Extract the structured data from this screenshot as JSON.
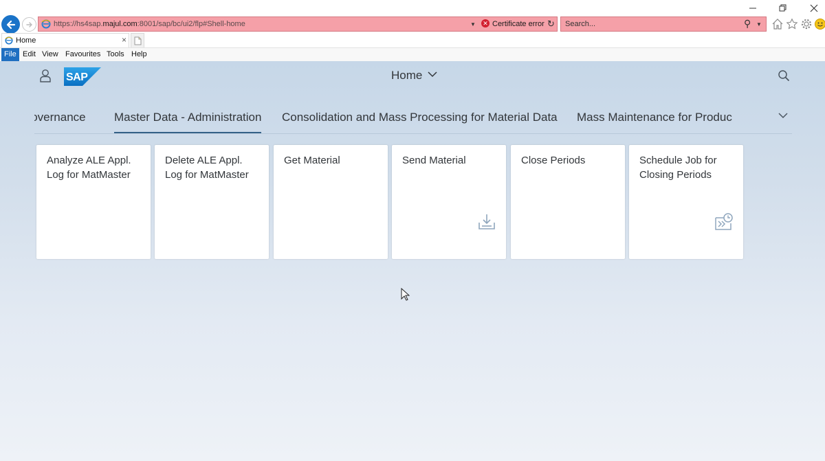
{
  "browser": {
    "address": {
      "url_prefix": "https://hs4sap.",
      "url_domain": "majul.com",
      "url_suffix": ":8001/sap/bc/ui2/flp#Shell-home",
      "certificate_text": "Certificate error"
    },
    "search": {
      "placeholder": "Search..."
    },
    "tab": {
      "label": "Home"
    },
    "menu": [
      "File",
      "Edit",
      "View",
      "Favourites",
      "Tools",
      "Help"
    ]
  },
  "shell": {
    "title": "Home"
  },
  "anchor_bar": {
    "items": [
      "Governance",
      "Master Data - Administration",
      "Consolidation and Mass Processing for Material Data",
      "Mass Maintenance for Produc"
    ],
    "selected_index": 1
  },
  "tiles": [
    {
      "title": "Analyze ALE Appl. Log for MatMaster",
      "icon": ""
    },
    {
      "title": "Delete ALE Appl. Log for MatMaster",
      "icon": ""
    },
    {
      "title": "Get Material",
      "icon": ""
    },
    {
      "title": "Send Material",
      "icon": "download-icon"
    },
    {
      "title": "Close Periods",
      "icon": ""
    },
    {
      "title": "Schedule Job for Closing Periods",
      "icon": "schedule-job-icon"
    }
  ],
  "colors": {
    "address_bar_error": "#f5a0a8",
    "sap_blue": "#1f8fd6",
    "tile_icon": "#8fa6bd",
    "selected_underline": "#346187"
  }
}
